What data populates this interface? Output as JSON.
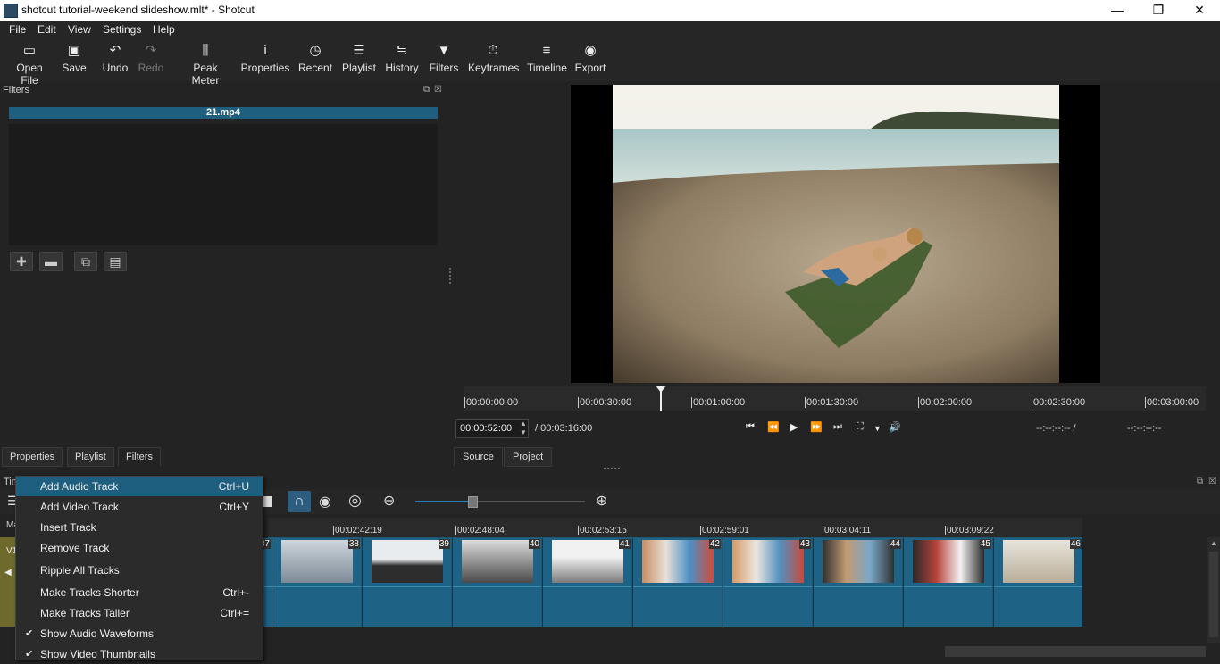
{
  "window": {
    "title": "shotcut tutorial-weekend slideshow.mlt* - Shotcut",
    "minimize": "—",
    "maximize": "❐",
    "close": "✕"
  },
  "menu": [
    "File",
    "Edit",
    "View",
    "Settings",
    "Help"
  ],
  "toolbar": [
    {
      "label": "Open File",
      "icon": "folder-icon",
      "glyph": "▭"
    },
    {
      "label": "Save",
      "icon": "save-icon",
      "glyph": "▣"
    },
    {
      "label": "Undo",
      "icon": "undo-icon",
      "glyph": "↶"
    },
    {
      "label": "Redo",
      "icon": "redo-icon",
      "glyph": "↷",
      "disabled": true
    },
    {
      "label": "Peak Meter",
      "icon": "peak-meter-icon",
      "glyph": "⫼"
    },
    {
      "label": "Properties",
      "icon": "info-icon",
      "glyph": "i"
    },
    {
      "label": "Recent",
      "icon": "clock-icon",
      "glyph": "◷"
    },
    {
      "label": "Playlist",
      "icon": "list-icon",
      "glyph": "☰"
    },
    {
      "label": "History",
      "icon": "history-icon",
      "glyph": "≒"
    },
    {
      "label": "Filters",
      "icon": "funnel-icon",
      "glyph": "▼"
    },
    {
      "label": "Keyframes",
      "icon": "stopwatch-icon",
      "glyph": "⏱"
    },
    {
      "label": "Timeline",
      "icon": "timeline-icon",
      "glyph": "≡"
    },
    {
      "label": "Export",
      "icon": "disc-icon",
      "glyph": "◉"
    }
  ],
  "filters": {
    "title": "Filters",
    "clip_name": "21.mp4",
    "add": "✚",
    "remove": "▬",
    "copy": "⧉",
    "paste": "▤"
  },
  "left_tabs": [
    "Properties",
    "Playlist",
    "Filters"
  ],
  "player": {
    "ruler_ticks": [
      "00:00:00:00",
      "00:00:30:00",
      "00:01:00:00",
      "00:01:30:00",
      "00:02:00:00",
      "00:02:30:00",
      "00:03:00:00"
    ],
    "current_time": "00:00:52:00",
    "duration": "/ 00:03:16:00",
    "in_point": "--:--:--:-- /",
    "out_point": "--:--:--:--",
    "tabs": [
      "Source",
      "Project"
    ]
  },
  "timeline": {
    "title": "Tim",
    "track_marker": "Ma",
    "track_label": "V1",
    "ruler_ticks": [
      "00:02:42:19",
      "00:02:48:04",
      "00:02:53:15",
      "00:02:59:01",
      "00:03:04:11",
      "00:03:09:22"
    ],
    "clips": [
      "37",
      "38",
      "39",
      "40",
      "41",
      "42",
      "43",
      "44",
      "45",
      "46"
    ]
  },
  "context_menu": [
    {
      "label": "Add Audio Track",
      "shortcut": "Ctrl+U",
      "highlighted": true
    },
    {
      "label": "Add Video Track",
      "shortcut": "Ctrl+Y"
    },
    {
      "label": "Insert Track",
      "shortcut": ""
    },
    {
      "label": "Remove Track",
      "shortcut": ""
    },
    {
      "label": "Ripple All Tracks",
      "shortcut": ""
    },
    {
      "label": "Make Tracks Shorter",
      "shortcut": "Ctrl+-"
    },
    {
      "label": "Make Tracks Taller",
      "shortcut": "Ctrl+="
    },
    {
      "label": "Show Audio Waveforms",
      "shortcut": "",
      "checked": true
    },
    {
      "label": "Show Video Thumbnails",
      "shortcut": "",
      "checked": true
    }
  ],
  "colors": {
    "accent": "#1e5f80",
    "clip": "#1e6285",
    "track_head": "#6e6a2b"
  }
}
